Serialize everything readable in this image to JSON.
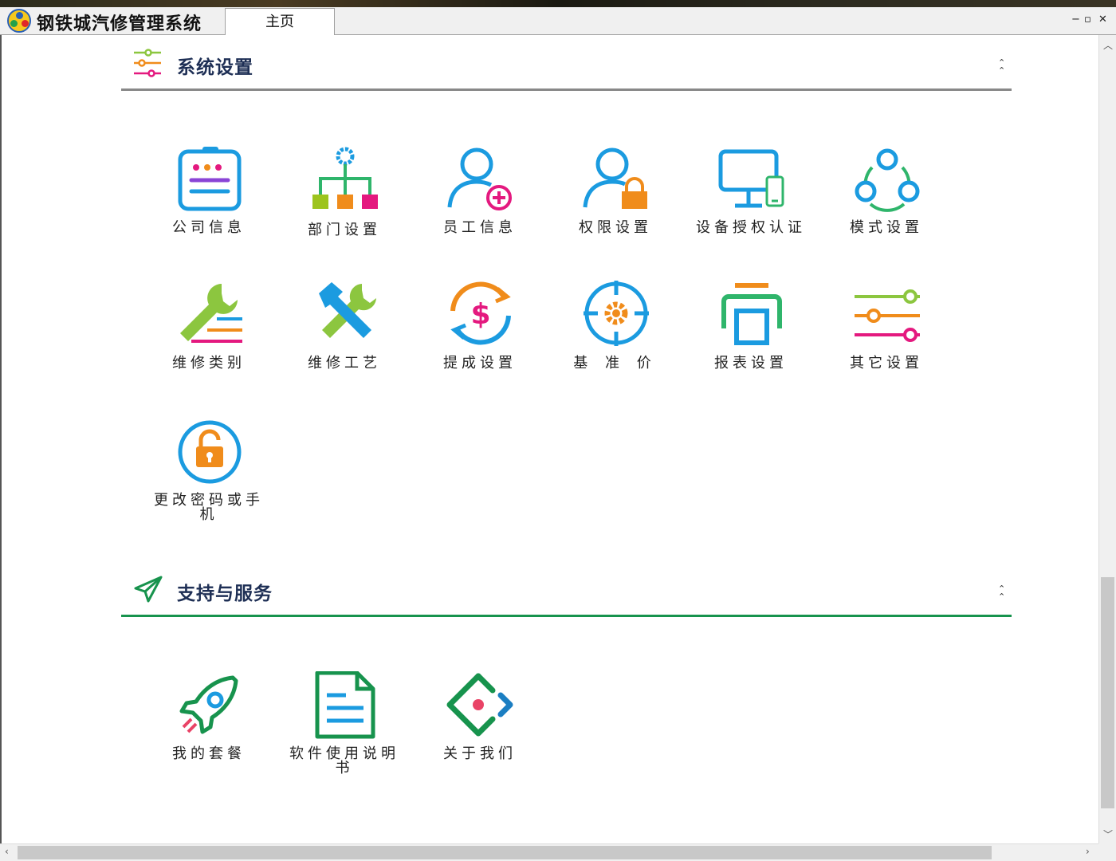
{
  "app": {
    "title": "钢铁城汽修管理系统"
  },
  "tabs": [
    {
      "label": "主页"
    }
  ],
  "window_controls": {
    "minimize": "−",
    "restore": "▫",
    "close": "✕"
  },
  "sections": [
    {
      "title": "系统设置",
      "accent": "#888888",
      "items": [
        {
          "label": "公司信息",
          "icon": "clipboard-icon"
        },
        {
          "label": "部门设置",
          "icon": "org-chart-icon"
        },
        {
          "label": "员工信息",
          "icon": "user-add-icon"
        },
        {
          "label": "权限设置",
          "icon": "user-lock-icon"
        },
        {
          "label": "设备授权认证",
          "icon": "devices-icon"
        },
        {
          "label": "模式设置",
          "icon": "share-nodes-icon"
        },
        {
          "label": "维修类别",
          "icon": "wrench-list-icon"
        },
        {
          "label": "维修工艺",
          "icon": "hammer-wrench-icon"
        },
        {
          "label": "提成设置",
          "icon": "dollar-cycle-icon"
        },
        {
          "label": "基 准 价",
          "icon": "target-gear-icon"
        },
        {
          "label": "报表设置",
          "icon": "printer-icon"
        },
        {
          "label": "其它设置",
          "icon": "sliders-icon"
        },
        {
          "label": "更改密码或手机",
          "icon": "lock-circle-icon"
        }
      ]
    },
    {
      "title": "支持与服务",
      "accent": "#17934d",
      "items": [
        {
          "label": "我的套餐",
          "icon": "rocket-icon"
        },
        {
          "label": "软件使用说明书",
          "icon": "document-icon"
        },
        {
          "label": "关于我们",
          "icon": "diamond-code-icon"
        }
      ]
    }
  ],
  "colors": {
    "blue": "#1b9be0",
    "pink": "#e4197f",
    "orange": "#f08c1b",
    "green": "#8cc63f",
    "teal": "#2fb56b",
    "darkblue": "#1e2f55",
    "red": "#e94366"
  }
}
